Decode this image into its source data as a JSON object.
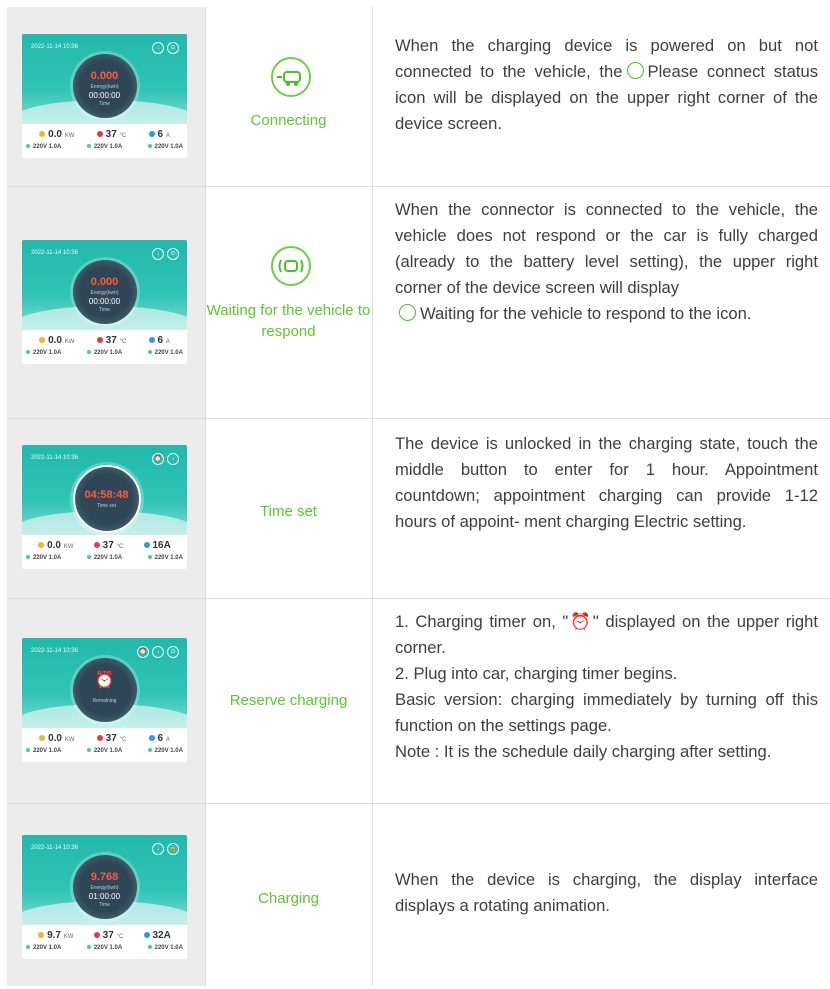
{
  "rows": [
    {
      "label": "Connecting",
      "desc": [
        "When the charging device is powered on but not connected to the vehicle, the",
        "Please connect status icon will be displayed on the upper right corner of the device screen."
      ],
      "screen": {
        "ts": "2022-11-14 10:36",
        "big": "0.000",
        "sub": "Energy(kwh)",
        "t2": "00:00:00",
        "sub2": "Time",
        "kw": "0.0",
        "kw_u": "KW",
        "temp": "37",
        "temp_u": "°C",
        "amp": "6",
        "amp_u": "A",
        "phases": [
          "220V 1.0A",
          "220V 1.0A",
          "220V 1.0A"
        ]
      }
    },
    {
      "label": "Waiting for the vehicle to respond",
      "desc": [
        "When the connector is connected to the vehicle, the vehicle does not respond or the car is fully charged (already to the battery level setting), the upper right corner of the device screen will display",
        "Waiting  for the vehicle to respond to the icon."
      ],
      "screen": {
        "ts": "2022-11-14 10:36",
        "big": "0.000",
        "sub": "Energy(kwh)",
        "t2": "00:00:00",
        "sub2": "Time",
        "kw": "0.0",
        "kw_u": "KW",
        "temp": "37",
        "temp_u": "°C",
        "amp": "6",
        "amp_u": "A",
        "phases": [
          "220V 1.0A",
          "220V 1.0A",
          "220V 1.0A"
        ]
      }
    },
    {
      "label": "Time set",
      "desc": [
        "The device is unlocked in the charging state, touch the middle button to enter for 1 hour. Appointment countdown; appointment charging can provide 1-12 hours of appoint- ment charging Electric setting."
      ],
      "screen": {
        "ts": "2022-11-14 10:36",
        "big": "04:58:48",
        "sub": "Time set",
        "t2": "",
        "sub2": "",
        "kw": "0.0",
        "kw_u": "KW",
        "temp": "37",
        "temp_u": "°C",
        "amp": "16A",
        "amp_u": "",
        "phases": [
          "220V 1.0A",
          "220V 1.0A",
          "220V 1.0A"
        ]
      }
    },
    {
      "label": "Reserve  charging",
      "desc": [
        "1. Charging timer  on, \"",
        "\" displayed on the upper right corner.",
        "2. Plug into car,  charging timer begins.",
        "Basic version:  charging immediately by turning off this function on the settings page.",
        "Note : It is the schedule daily charging after setting."
      ],
      "screen": {
        "ts": "2022-11-14 10:36",
        "big": "",
        "sub": "Remaining",
        "t2": "",
        "sub2": "",
        "kw": "0.0",
        "kw_u": "KW",
        "temp": "37",
        "temp_u": "°C",
        "amp": "6",
        "amp_u": "A",
        "phases": [
          "220V 1.0A",
          "220V 1.0A",
          "220V 1.0A"
        ]
      }
    },
    {
      "label": "Charging",
      "desc": [
        "When the device is charging, the display interface displays a rotating animation."
      ],
      "screen": {
        "ts": "2022-11-14 10:36",
        "big": "9.768",
        "sub": "Energy(kwh)",
        "t2": "01:00:00",
        "sub2": "Time",
        "kw": "9.7",
        "kw_u": "KW",
        "temp": "37",
        "temp_u": "°C",
        "amp": "32A",
        "amp_u": "",
        "phases": [
          "220V 1.0A",
          "220V 1.0A",
          "220V 1.0A"
        ]
      }
    }
  ],
  "colors": {
    "accent": "#5cc730",
    "text": "#3e3e3e",
    "grid": "#dcdcdc",
    "firstcol": "#ececec"
  }
}
